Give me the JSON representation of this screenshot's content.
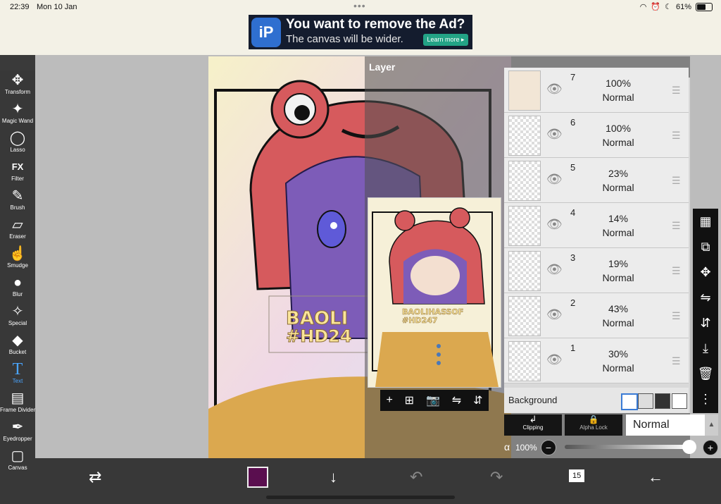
{
  "status": {
    "time": "22:39",
    "date": "Mon 10 Jan",
    "dots": "•••",
    "battery": "61%",
    "battery_level": 0.61
  },
  "ad": {
    "title": "You want to remove the Ad?",
    "subtitle": "The canvas will be wider.",
    "cta": "Learn more ▸",
    "logo": "iP"
  },
  "tools": [
    {
      "label": "Transform",
      "icon": "✥"
    },
    {
      "label": "Magic Wand",
      "icon": "✦"
    },
    {
      "label": "Lasso",
      "icon": "◯"
    },
    {
      "label": "Filter",
      "icon": "FX"
    },
    {
      "label": "Brush",
      "icon": "✎"
    },
    {
      "label": "Eraser",
      "icon": "▱"
    },
    {
      "label": "Smudge",
      "icon": "☝"
    },
    {
      "label": "Blur",
      "icon": "●"
    },
    {
      "label": "Special",
      "icon": "✧"
    },
    {
      "label": "Bucket",
      "icon": "◆"
    },
    {
      "label": "Text",
      "icon": "T"
    },
    {
      "label": "Frame Divider",
      "icon": "▤"
    },
    {
      "label": "Eyedropper",
      "icon": "✒"
    },
    {
      "label": "Canvas",
      "icon": "▢"
    }
  ],
  "layer_panel": {
    "title": "Layer"
  },
  "layers": [
    {
      "num": "7",
      "opacity": "100%",
      "blend": "Normal"
    },
    {
      "num": "6",
      "opacity": "100%",
      "blend": "Normal"
    },
    {
      "num": "5",
      "opacity": "23%",
      "blend": "Normal"
    },
    {
      "num": "4",
      "opacity": "14%",
      "blend": "Normal"
    },
    {
      "num": "3",
      "opacity": "19%",
      "blend": "Normal"
    },
    {
      "num": "2",
      "opacity": "43%",
      "blend": "Normal"
    },
    {
      "num": "1",
      "opacity": "30%",
      "blend": "Normal"
    }
  ],
  "background": {
    "label": "Background"
  },
  "blend": {
    "clipping": "Clipping",
    "alpha_lock": "Alpha Lock",
    "mode": "Normal"
  },
  "opacity": {
    "symbol": "α",
    "value": "100%",
    "minus": "−",
    "plus": "+"
  },
  "bottom": {
    "history_count": "15"
  },
  "colors": {
    "current": "#5a0e4f"
  }
}
